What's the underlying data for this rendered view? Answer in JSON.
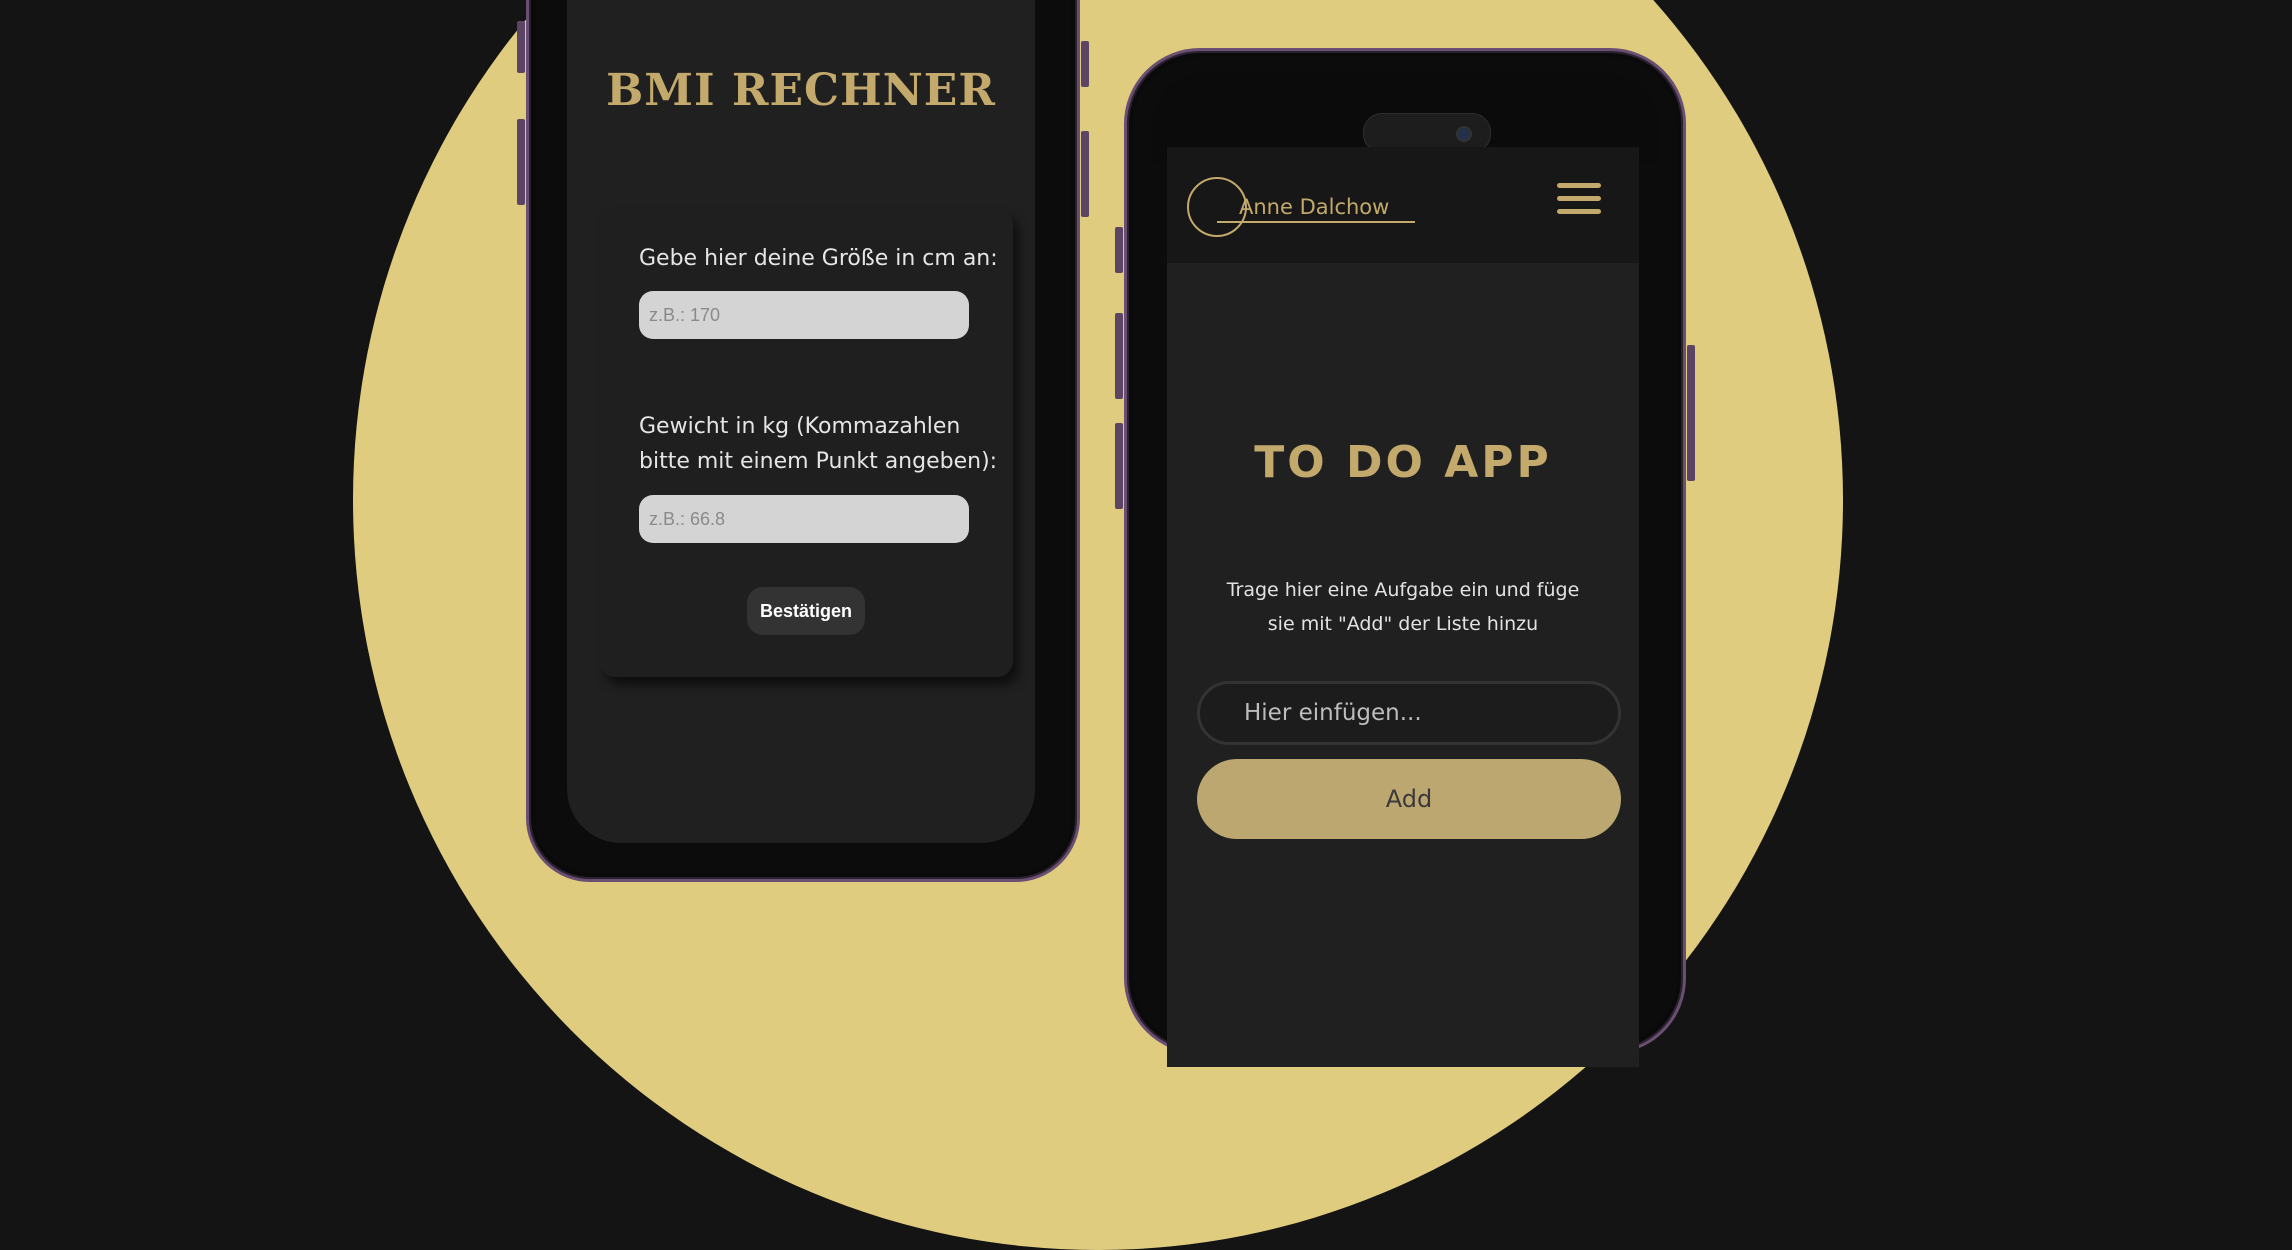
{
  "colors": {
    "accent_gold": "#c3a96b",
    "background": "#141414",
    "circle": "#dfcc7f",
    "frame": "#6b4f72"
  },
  "bmi": {
    "title": "BMI RECHNER",
    "height_label": "Gebe hier deine Größe in cm an:",
    "height_placeholder": "z.B.: 170",
    "weight_label_line1": "Gewicht in kg (Kommazahlen",
    "weight_label_line2": "bitte mit einem Punkt angeben):",
    "weight_placeholder": "z.B.: 66.8",
    "submit_label": "Bestätigen"
  },
  "todo": {
    "brand": "Anne Dalchow",
    "menu_icon": "hamburger-menu-icon",
    "title": "TO DO APP",
    "desc_line1": "Trage hier eine Aufgabe ein und füge",
    "desc_line2": "sie mit \"Add\" der Liste hinzu",
    "input_placeholder": "Hier einfügen...",
    "add_label": "Add"
  }
}
